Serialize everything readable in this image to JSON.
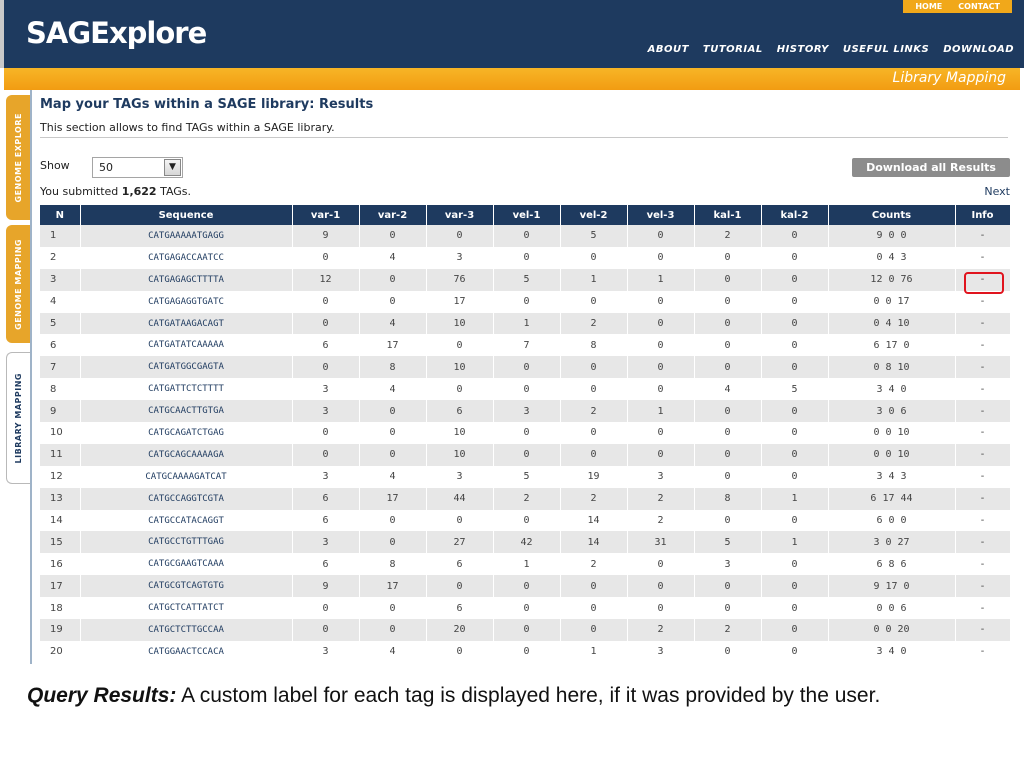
{
  "header": {
    "logo": "SAGExplore",
    "top_links": [
      "HOME",
      "CONTACT"
    ],
    "nav": [
      "ABOUT",
      "TUTORIAL",
      "HISTORY",
      "USEFUL LINKS",
      "DOWNLOAD"
    ],
    "section_title": "Library Mapping"
  },
  "side_tabs": [
    "GENOME EXPLORE",
    "GENOME MAPPING",
    "LIBRARY MAPPING"
  ],
  "page": {
    "title": "Map your TAGs within a SAGE library: Results",
    "description": "This section allows to find TAGs within a SAGE library.",
    "show_label": "Show",
    "show_value": "50",
    "download_button": "Download all Results",
    "submitted_prefix": "You submitted ",
    "submitted_count": "1,622",
    "submitted_suffix": " TAGs.",
    "next_link": "Next"
  },
  "table": {
    "columns": [
      "N",
      "Sequence",
      "var-1",
      "var-2",
      "var-3",
      "vel-1",
      "vel-2",
      "vel-3",
      "kal-1",
      "kal-2",
      "Counts",
      "Info"
    ],
    "rows": [
      [
        "1",
        "CATGAAAAATGAGG",
        "9",
        "0",
        "0",
        "0",
        "5",
        "0",
        "2",
        "0",
        "9 0 0",
        "-"
      ],
      [
        "2",
        "CATGAGACCAATCC",
        "0",
        "4",
        "3",
        "0",
        "0",
        "0",
        "0",
        "0",
        "0 4 3",
        "-"
      ],
      [
        "3",
        "CATGAGAGCTTTTA",
        "12",
        "0",
        "76",
        "5",
        "1",
        "1",
        "0",
        "0",
        "12 0 76",
        "-"
      ],
      [
        "4",
        "CATGAGAGGTGATC",
        "0",
        "0",
        "17",
        "0",
        "0",
        "0",
        "0",
        "0",
        "0 0 17",
        "-"
      ],
      [
        "5",
        "CATGATAAGACAGT",
        "0",
        "4",
        "10",
        "1",
        "2",
        "0",
        "0",
        "0",
        "0 4 10",
        "-"
      ],
      [
        "6",
        "CATGATATCAAAAA",
        "6",
        "17",
        "0",
        "7",
        "8",
        "0",
        "0",
        "0",
        "6 17 0",
        "-"
      ],
      [
        "7",
        "CATGATGGCGAGTA",
        "0",
        "8",
        "10",
        "0",
        "0",
        "0",
        "0",
        "0",
        "0 8 10",
        "-"
      ],
      [
        "8",
        "CATGATTCTCTTTT",
        "3",
        "4",
        "0",
        "0",
        "0",
        "0",
        "4",
        "5",
        "3 4 0",
        "-"
      ],
      [
        "9",
        "CATGCAACTTGTGA",
        "3",
        "0",
        "6",
        "3",
        "2",
        "1",
        "0",
        "0",
        "3 0 6",
        "-"
      ],
      [
        "10",
        "CATGCAGATCTGAG",
        "0",
        "0",
        "10",
        "0",
        "0",
        "0",
        "0",
        "0",
        "0 0 10",
        "-"
      ],
      [
        "11",
        "CATGCAGCAAAAGA",
        "0",
        "0",
        "10",
        "0",
        "0",
        "0",
        "0",
        "0",
        "0 0 10",
        "-"
      ],
      [
        "12",
        "CATGCAAAAGATCAT",
        "3",
        "4",
        "3",
        "5",
        "19",
        "3",
        "0",
        "0",
        "3 4 3",
        "-"
      ],
      [
        "13",
        "CATGCCAGGTCGTA",
        "6",
        "17",
        "44",
        "2",
        "2",
        "2",
        "8",
        "1",
        "6 17 44",
        "-"
      ],
      [
        "14",
        "CATGCCATACAGGT",
        "6",
        "0",
        "0",
        "0",
        "14",
        "2",
        "0",
        "0",
        "6 0 0",
        "-"
      ],
      [
        "15",
        "CATGCCTGTTTGAG",
        "3",
        "0",
        "27",
        "42",
        "14",
        "31",
        "5",
        "1",
        "3 0 27",
        "-"
      ],
      [
        "16",
        "CATGCGAAGTCAAA",
        "6",
        "8",
        "6",
        "1",
        "2",
        "0",
        "3",
        "0",
        "6 8 6",
        "-"
      ],
      [
        "17",
        "CATGCGTCAGTGTG",
        "9",
        "17",
        "0",
        "0",
        "0",
        "0",
        "0",
        "0",
        "9 17 0",
        "-"
      ],
      [
        "18",
        "CATGCTCATTATCT",
        "0",
        "0",
        "6",
        "0",
        "0",
        "0",
        "0",
        "0",
        "0 0 6",
        "-"
      ],
      [
        "19",
        "CATGCTCTTGCCAA",
        "0",
        "0",
        "20",
        "0",
        "0",
        "2",
        "2",
        "0",
        "0 0 20",
        "-"
      ],
      [
        "20",
        "CATGGAACTCCACA",
        "3",
        "4",
        "0",
        "0",
        "1",
        "3",
        "0",
        "0",
        "3 4 0",
        "-"
      ]
    ]
  },
  "caption": {
    "strong": "Query Results:",
    "text": " A custom label for each tag is displayed here, if it was provided by the user."
  },
  "colors": {
    "header_bg": "#1e3a5f",
    "accent_orange": "#f29c12",
    "highlight_red": "#e0141e"
  }
}
